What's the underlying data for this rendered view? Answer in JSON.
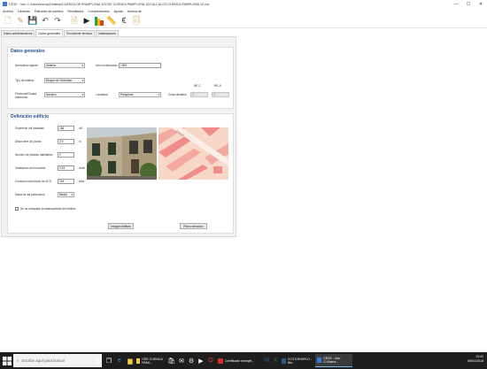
{
  "window": {
    "title": "CE3X - nos: C:\\Users\\mmoy\\Desktop\\CUENCA DE IRAMPLONA 12\\CEE CUENCA PAMPLONA 12\\CALCULOS CUENCA PAMPLONA 12.cex",
    "minimize": "—",
    "maximize": "☐",
    "close": "✕"
  },
  "menu": [
    "Archivo",
    "Librerías",
    "Patrones de sombra",
    "Resultados",
    "Complementos",
    "Ayuda",
    "Acerca de"
  ],
  "tabs": [
    "Datos administrativos",
    "Datos generales",
    "Envolvente térmica",
    "Instalaciones"
  ],
  "active_tab": 1,
  "datos_generales": {
    "title": "Datos generales",
    "normativa_label": "Normativa vigente",
    "normativa_value": "Anterior",
    "anio_label": "Año construcción",
    "anio_value": "1959",
    "tipo_label": "Tipo de edificio",
    "tipo_value": "Bloque de Viviendas",
    "provincia_label": "Provincia/Ciudad autónoma",
    "provincia_value": "Navarra",
    "localidad_label": "Localidad",
    "localidad_value": "Pamplona",
    "zona_label": "Zona climática",
    "hec_label": "HE-C",
    "hea_label": "HE-A",
    "zona_c_value": "D",
    "zona_a_value": "D"
  },
  "definicion": {
    "title": "Definición edificio",
    "superficie_label": "Superficie útil habitable",
    "superficie_value": "186",
    "superficie_unit": "m2",
    "altura_label": "Altura libre de planta",
    "altura_value": "2.5",
    "altura_unit": "m",
    "plantas_label": "Número de plantas habitables",
    "plantas_value": "2",
    "ventilacion_label": "Ventilación del inmueble",
    "ventilacion_value": "0.63",
    "ventilacion_unit": "ren/h",
    "acs_label": "Consumo total diario de ACS",
    "acs_value": "244",
    "acs_unit": "l/día",
    "masa_label": "Masa de las particiones",
    "masa_value": "Media",
    "checkbox_label": "Se ha ensayado la estanqueidad del edificio",
    "imagen_button": "Imagen edificio",
    "plano_button": "Plano situación"
  },
  "taskbar": {
    "search_placeholder": "Escribe aquí para buscar",
    "apps": [
      "CEE CUENCA PAMI...",
      "Certificado energét...",
      "CC3 EJEMPLO - Wo...",
      "CE3X - nos: C:\\Users..."
    ],
    "time": "13:41",
    "date": "06/01/2018"
  },
  "colors": {
    "accent": "#1f4e8c",
    "taskbar": "#1e1e1e"
  }
}
